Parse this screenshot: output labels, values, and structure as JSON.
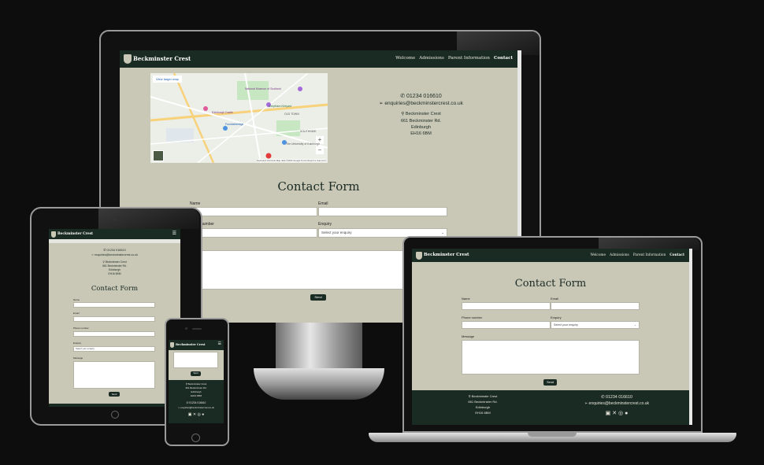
{
  "site": {
    "brand": "Beckminster Crest",
    "nav": [
      "Welcome",
      "Admissions",
      "Parent Information",
      "Contact"
    ],
    "phone": "01234 016610",
    "email": "enquiries@beckminstercrest.co.uk",
    "address": [
      "Beckminster Crest",
      "661 Beckminster Rd.",
      "Edinburgh",
      "EH16 6BM"
    ],
    "map_link": "View larger map",
    "map_footer": "Keyboard shortcuts   Map data ©2024 Google   Terms   Report a map error",
    "map_zoom_in": "+",
    "map_zoom_out": "−",
    "map_labels": [
      "OLD TOWN",
      "Edinburgh Castle",
      "Greyfriars Kirkyard",
      "The University of Edinburgh",
      "National Museum of Scotland",
      "Fountainbridge",
      "SOUTHSIDE"
    ]
  },
  "form": {
    "title": "Contact Form",
    "name_label": "Name",
    "email_label": "Email",
    "phone_label": "Phone number",
    "phone_label_clip": "number",
    "enquiry_label": "Enquiry",
    "enquiry_placeholder": "Select your enquiry",
    "message_label": "Message",
    "send_label": "Send",
    "send_clip": "Send"
  },
  "colors": {
    "nav_bg": "#1a2b24",
    "page_bg": "#c9c7b6",
    "backdrop": "#0d0d0d"
  },
  "icons": [
    "phone-icon",
    "paper-plane-icon",
    "map-pin-icon",
    "hamburger-icon",
    "linkedin-icon",
    "x-icon",
    "instagram-icon",
    "facebook-icon"
  ]
}
